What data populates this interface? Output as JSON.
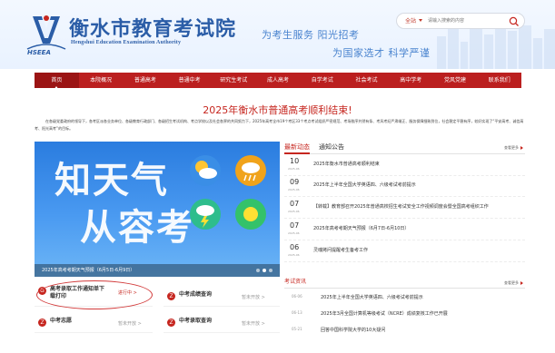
{
  "header": {
    "title": "衡水市教育考试院",
    "subtitle": "Hengshui Education Examination Authority",
    "logo_text": "HSEEA",
    "slogan_line1": "为考生服务 阳光招考",
    "slogan_line2": "为国家选才 科学严谨",
    "search": {
      "scope": "全站",
      "placeholder": "请输入搜索的内容"
    }
  },
  "nav": {
    "items": [
      "首页",
      "本院概况",
      "普通高考",
      "普通中考",
      "研究生考试",
      "成人高考",
      "自学考试",
      "社会考试",
      "高中学考",
      "党风党建",
      "联系我们"
    ]
  },
  "headline": "2025年衡水市普通高考顺利结束!",
  "intro": "在各级党委政府的领导下，各考区派各业务单位、各级教育行政部门、各级招生考试机构、考点学校以及社会各界的共同努力下，2025年高考全市19个考区33个考点考试组织严密规范、考场秩序井然有条、考风考纪严肃端正、服务保障细致到位，社会稳定平稳有序，较好实现了“平安高考、诚信高考、阳光高考”的目标。",
  "banner": {
    "text_line1": "知天气",
    "text_line2": "从容考",
    "caption": "2025年高考考期天气预报（6月5日-6月9日）"
  },
  "quick_links": [
    {
      "label": "高考录取工作通知单下载打印",
      "status": "进行中 >",
      "icon": "G"
    },
    {
      "label": "中考成绩查询",
      "status": "暂未开放 >",
      "icon": "Z"
    },
    {
      "label": "中考志愿",
      "status": "暂未开放 >",
      "icon": "Z"
    },
    {
      "label": "中考录取查询",
      "status": "暂未开放 >",
      "icon": "Z"
    }
  ],
  "news": {
    "tabs": [
      "最新动态",
      "通知公告"
    ],
    "more_label": "查看更多",
    "items": [
      {
        "day": "10",
        "month": "2025-06",
        "title": "2025年衡水市普通高考顺利结束"
      },
      {
        "day": "09",
        "month": "2025-06",
        "title": "2025年上半年全国大学英语四、六级考试考前提示"
      },
      {
        "day": "07",
        "month": "2025-06",
        "title": "【转载】教育部召开2025年普通高校招生考试安全工作视频调度会暨全国高考组织工作"
      },
      {
        "day": "07",
        "month": "2025-06",
        "title": "2025年高考考期天气预报（6月7日-6月10日）"
      },
      {
        "day": "06",
        "month": "2025-06",
        "title": "灵魂拷问提醒考生备考工作"
      }
    ]
  },
  "exam_news": {
    "title": "考试资讯",
    "more_label": "查看更多",
    "items": [
      {
        "date": "06-06",
        "title": "2025年上半年全国大学英语四、六级考试考前提示"
      },
      {
        "date": "06-13",
        "title": "2025年3月全国计算机等级考试（NCRE）成绩复核工作已开展"
      },
      {
        "date": "05-21",
        "title": "回答中国科学院大学的10大疑问"
      }
    ]
  },
  "colors": {
    "brand_red": "#bb1f1f",
    "brand_blue": "#2b5da7",
    "accent_red": "#c6261f"
  }
}
